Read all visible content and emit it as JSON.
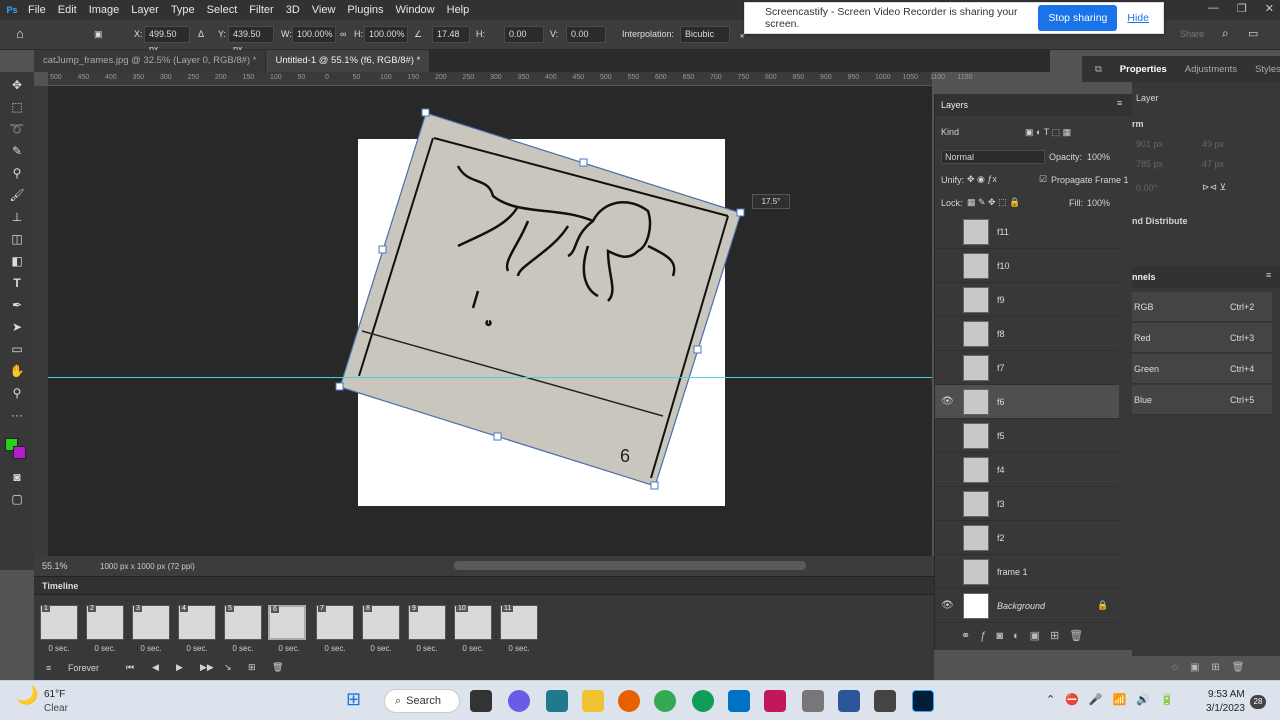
{
  "menubar": {
    "logo": "Ps",
    "items": [
      "File",
      "Edit",
      "Image",
      "Layer",
      "Type",
      "Select",
      "Filter",
      "3D",
      "View",
      "Plugins",
      "Window",
      "Help"
    ]
  },
  "options": {
    "x_label": "X:",
    "x": "499.50 px",
    "y_label": "Y:",
    "y": "439.50 px",
    "w_label": "W:",
    "w": "100.00%",
    "h_label": "H:",
    "h": "100.00%",
    "angle": "17.48",
    "hskew_label": "H:",
    "hskew": "0.00",
    "vskew_label": "V:",
    "vskew": "0.00",
    "interp_label": "Interpolation:",
    "interp": "Bicubic",
    "share": "Share"
  },
  "share_banner": {
    "text": "Screencastify - Screen Video Recorder is sharing your screen.",
    "stop": "Stop sharing",
    "hide": "Hide"
  },
  "tabs": [
    {
      "label": "catJump_frames.jpg @ 32.5% (Layer 0, RGB/8#) *"
    },
    {
      "label": "Untitled-1 @ 55.1% (f6, RGB/8#) *"
    }
  ],
  "ruler": {
    "ticks": [
      "500",
      "450",
      "400",
      "350",
      "300",
      "250",
      "200",
      "150",
      "100",
      "50",
      "0",
      "50",
      "100",
      "150",
      "200",
      "250",
      "300",
      "350",
      "400",
      "450",
      "500",
      "550",
      "600",
      "650",
      "700",
      "750",
      "800",
      "850",
      "900",
      "950",
      "1000",
      "1050",
      "1100",
      "1150"
    ]
  },
  "canvas": {
    "angle_tooltip": "17.5°",
    "frame_number": "6"
  },
  "status": {
    "zoom": "55.1%",
    "doc": "1000 px x 1000 px (72 ppi)"
  },
  "timeline": {
    "title": "Timeline",
    "frames": [
      {
        "n": "1",
        "d": "0 sec."
      },
      {
        "n": "2",
        "d": "0 sec."
      },
      {
        "n": "3",
        "d": "0 sec."
      },
      {
        "n": "4",
        "d": "0 sec."
      },
      {
        "n": "5",
        "d": "0 sec."
      },
      {
        "n": "6",
        "d": "0 sec."
      },
      {
        "n": "7",
        "d": "0 sec."
      },
      {
        "n": "8",
        "d": "0 sec."
      },
      {
        "n": "9",
        "d": "0 sec."
      },
      {
        "n": "10",
        "d": "0 sec."
      },
      {
        "n": "11",
        "d": "0 sec."
      }
    ],
    "loop": "Forever"
  },
  "layers": {
    "title": "Layers",
    "filter": "Kind",
    "blend": "Normal",
    "opacity_label": "Opacity:",
    "opacity": "100%",
    "unify_label": "Unify:",
    "propagate": "Propagate Frame 1",
    "lock_label": "Lock:",
    "fill_label": "Fill:",
    "fill": "100%",
    "items": [
      {
        "name": "f11"
      },
      {
        "name": "f10"
      },
      {
        "name": "f9"
      },
      {
        "name": "f8"
      },
      {
        "name": "f7"
      },
      {
        "name": "f6"
      },
      {
        "name": "f5"
      },
      {
        "name": "f4"
      },
      {
        "name": "f3"
      },
      {
        "name": "f2"
      },
      {
        "name": "frame 1"
      },
      {
        "name": "Background"
      }
    ]
  },
  "properties": {
    "tabs": [
      "Properties",
      "Adjustments",
      "Styles"
    ],
    "layer_label": "Layer",
    "transform_label": "rm",
    "distribute_label": "nd Distribute",
    "v1": "901 px",
    "v2": "49 px",
    "v3": "785 px",
    "v4": "47 px",
    "angle": "0.00°"
  },
  "channels": {
    "title": "nnels",
    "items": [
      {
        "name": "RGB",
        "key": "Ctrl+2"
      },
      {
        "name": "Red",
        "key": "Ctrl+3"
      },
      {
        "name": "Green",
        "key": "Ctrl+4"
      },
      {
        "name": "Blue",
        "key": "Ctrl+5"
      }
    ]
  },
  "taskbar": {
    "weather_temp": "61°F",
    "weather_desc": "Clear",
    "search": "Search",
    "time": "9:53 AM",
    "date": "3/1/2023",
    "badge": "28"
  }
}
